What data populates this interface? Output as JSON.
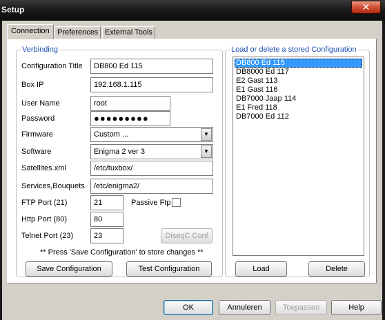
{
  "window": {
    "title": "Setup",
    "close_glyph": "✕"
  },
  "tabs": [
    {
      "label": "Connection",
      "active": true
    },
    {
      "label": "Preferences",
      "active": false
    },
    {
      "label": "External Tools",
      "active": false
    }
  ],
  "verbinding": {
    "group_label": "Verbinding",
    "configuration_title": {
      "label": "Configuration Title",
      "value": "DB800 Ed 115"
    },
    "box_ip": {
      "label": "Box IP",
      "value": "192.168.1.115"
    },
    "user_name": {
      "label": "User Name",
      "value": "root"
    },
    "password": {
      "label": "Password",
      "value": "●●●●●●●●●"
    },
    "firmware": {
      "label": "Firmware",
      "value": "Custom ..."
    },
    "software": {
      "label": "Software",
      "value": "Enigma 2 ver 3"
    },
    "satellites_xml": {
      "label": "Satellites.xml",
      "value": "/etc/tuxbox/"
    },
    "services_bouquets": {
      "label": "Services,Bouquets",
      "value": "/etc/enigma2/"
    },
    "ftp_port": {
      "label": "FTP Port (21)",
      "value": "21"
    },
    "passive_ftp": {
      "label": "Passive Ftp",
      "checked": false
    },
    "http_port": {
      "label": "Http Port (80)",
      "value": "80"
    },
    "telnet_port": {
      "label": "Telnet Port (23)",
      "value": "23"
    },
    "diseqc_button": "DiseqC Conf",
    "note": "** Press 'Save Configuration' to store changes **",
    "save_button": "Save Configuration",
    "test_button": "Test Configuration"
  },
  "stored": {
    "group_label": "Load or delete a stored Configuration",
    "items": [
      {
        "label": "DB800 Ed 115",
        "selected": true
      },
      {
        "label": "DB8000 Ed 117",
        "selected": false
      },
      {
        "label": "E2 Gast 113",
        "selected": false
      },
      {
        "label": "E1 Gast 116",
        "selected": false
      },
      {
        "label": "DB7000 Jaap 114",
        "selected": false
      },
      {
        "label": "E1 Fred 118",
        "selected": false
      },
      {
        "label": "DB7000 Ed 112",
        "selected": false
      }
    ],
    "load_button": "Load",
    "delete_button": "Delete"
  },
  "footer": {
    "ok": "OK",
    "annuleren": "Annuleren",
    "toepassen": "Toepassen",
    "help": "Help"
  },
  "icons": {
    "dropdown_arrow": "▼"
  }
}
